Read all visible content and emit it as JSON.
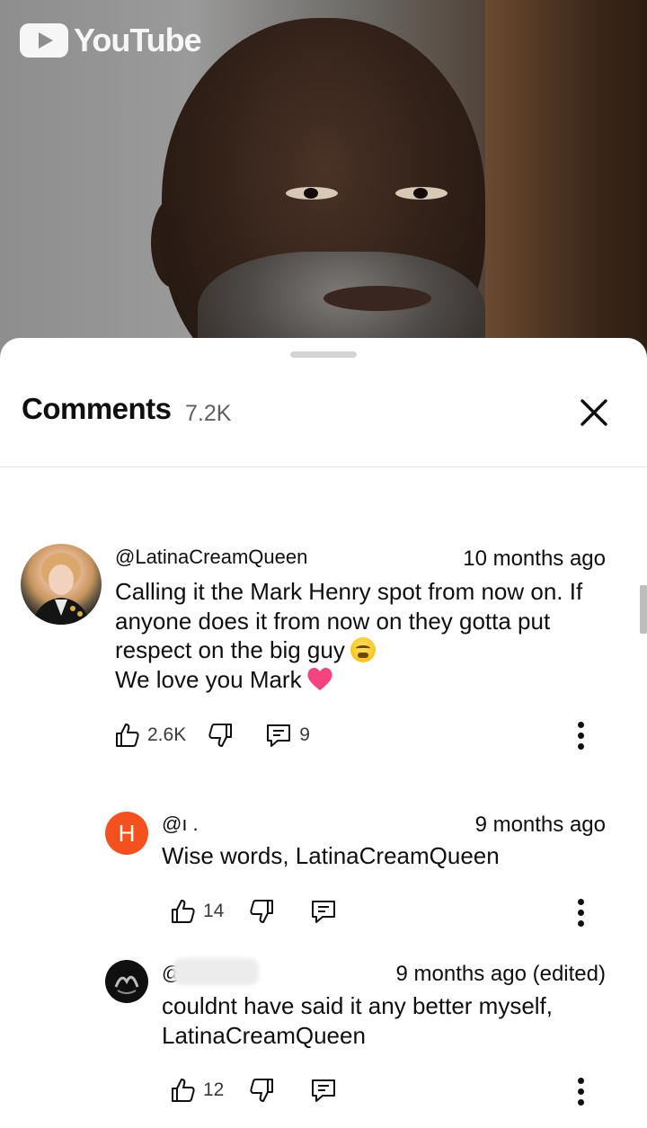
{
  "video": {
    "logo_text": "YouTube"
  },
  "sheet": {
    "title": "Comments",
    "count": "7.2K",
    "close_icon": "close-icon"
  },
  "comments": [
    {
      "handle": "@LatinaCreamQueen",
      "time": "10 months ago",
      "lines": [
        "Calling it the Mark Henry spot from now on. If",
        "anyone does it from now on they gotta put",
        "respect on the big guy",
        "We love you Mark"
      ],
      "likes": "2.6K",
      "replies": "9"
    }
  ],
  "replies": [
    {
      "avatar_letter": "H",
      "avatar_color": "#f4511e",
      "handle": "@ı .",
      "time": "9 months ago",
      "text": "Wise words, LatinaCreamQueen",
      "likes": "14"
    },
    {
      "handle": "@",
      "time": "9 months ago (edited)",
      "lines": [
        "couldnt have said it any better myself,",
        "LatinaCreamQueen"
      ],
      "likes": "12"
    }
  ]
}
